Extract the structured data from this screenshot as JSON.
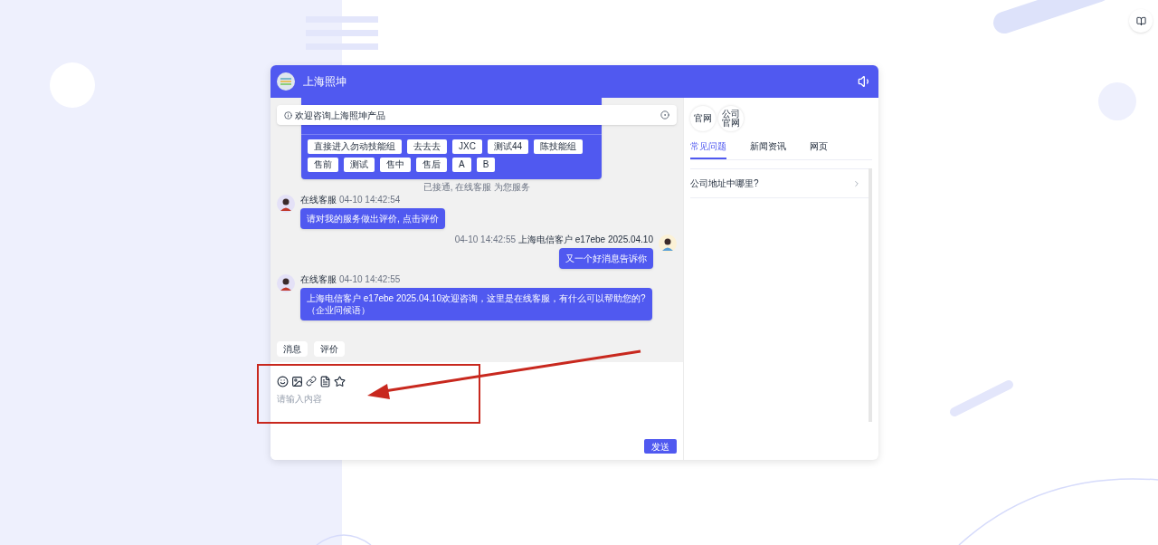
{
  "header": {
    "title": "上海照坤"
  },
  "notice": {
    "text": "欢迎咨询上海照坤产品"
  },
  "menu_card": {
    "option_rows": [
      [
        "直接进入勿动技能组",
        "去去去",
        "JXC",
        "测试44",
        "陈技能组"
      ],
      [
        "售前",
        "测试",
        "售中",
        "售后",
        "A",
        "B"
      ]
    ]
  },
  "system_note": "已接通, 在线客服 为您服务",
  "messages": [
    {
      "kind": "agent",
      "sender": "在线客服",
      "time": "04-10 14:42:54",
      "text": "请对我的服务做出评价, 点击评价"
    },
    {
      "kind": "customer",
      "sender": "上海电信客户 e17ebe 2025.04.10",
      "time": "04-10 14:42:55",
      "text": "又一个好消息告诉你"
    },
    {
      "kind": "agent",
      "sender": "在线客服",
      "time": "04-10 14:42:55",
      "text": "上海电信客户 e17ebe 2025.04.10欢迎咨询，这里是在线客服，有什么可以帮助您的?\n（企业问候语）"
    }
  ],
  "quick_replies": [
    "消息",
    "评价"
  ],
  "composer": {
    "placeholder": "请输入内容",
    "send": "发送"
  },
  "sidebar": {
    "links": [
      "官网",
      "公司官网"
    ],
    "tabs": [
      {
        "label": "常见问题",
        "selected": true
      },
      {
        "label": "新闻资讯",
        "selected": false
      },
      {
        "label": "网页",
        "selected": false
      }
    ],
    "faq": [
      "公司地址中哪里?"
    ]
  }
}
